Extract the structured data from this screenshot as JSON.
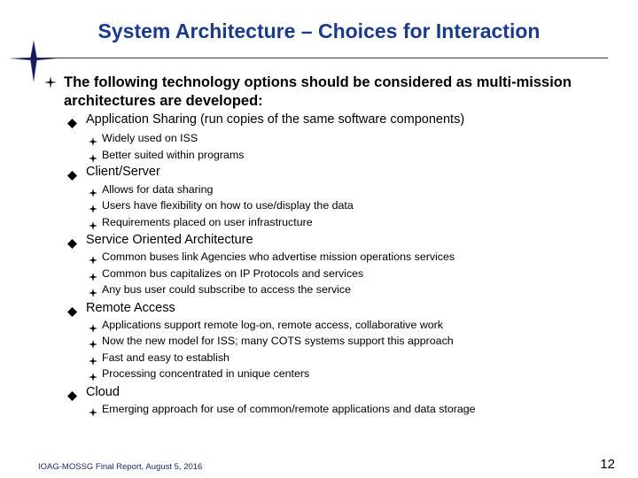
{
  "slide": {
    "title": "System Architecture – Choices for Interaction",
    "intro": "The following technology options should be considered as multi-mission architectures are developed:",
    "options": [
      {
        "label": "Application Sharing (run copies of the same software components)",
        "points": [
          "Widely used on ISS",
          "Better suited within programs"
        ]
      },
      {
        "label": "Client/Server",
        "points": [
          "Allows for data sharing",
          "Users have flexibility on how to use/display the data",
          "Requirements placed on user infrastructure"
        ]
      },
      {
        "label": "Service Oriented Architecture",
        "points": [
          "Common buses link Agencies who advertise mission operations services",
          "Common bus capitalizes on IP Protocols and services",
          "Any bus user could subscribe to access the service"
        ]
      },
      {
        "label": "Remote Access",
        "points": [
          "Applications support remote log-on, remote access, collaborative work",
          "Now the new model for ISS; many COTS systems support this approach",
          "Fast and easy to establish",
          "Processing concentrated in unique centers"
        ]
      },
      {
        "label": "Cloud",
        "points": [
          "Emerging approach for use of common/remote applications and data storage"
        ]
      }
    ],
    "footer": "IOAG-MOSSG Final Report, August 5, 2016",
    "page_number": "12"
  },
  "icons": {
    "logo": "four-point-star-icon",
    "level1_bullet": "four-point-star-icon",
    "level2_bullet": "diamond-icon",
    "level3_bullet": "four-point-star-icon"
  },
  "colors": {
    "title": "#1a3a8c",
    "logo_star": "#141a5c",
    "rule": "#3a3a48"
  }
}
